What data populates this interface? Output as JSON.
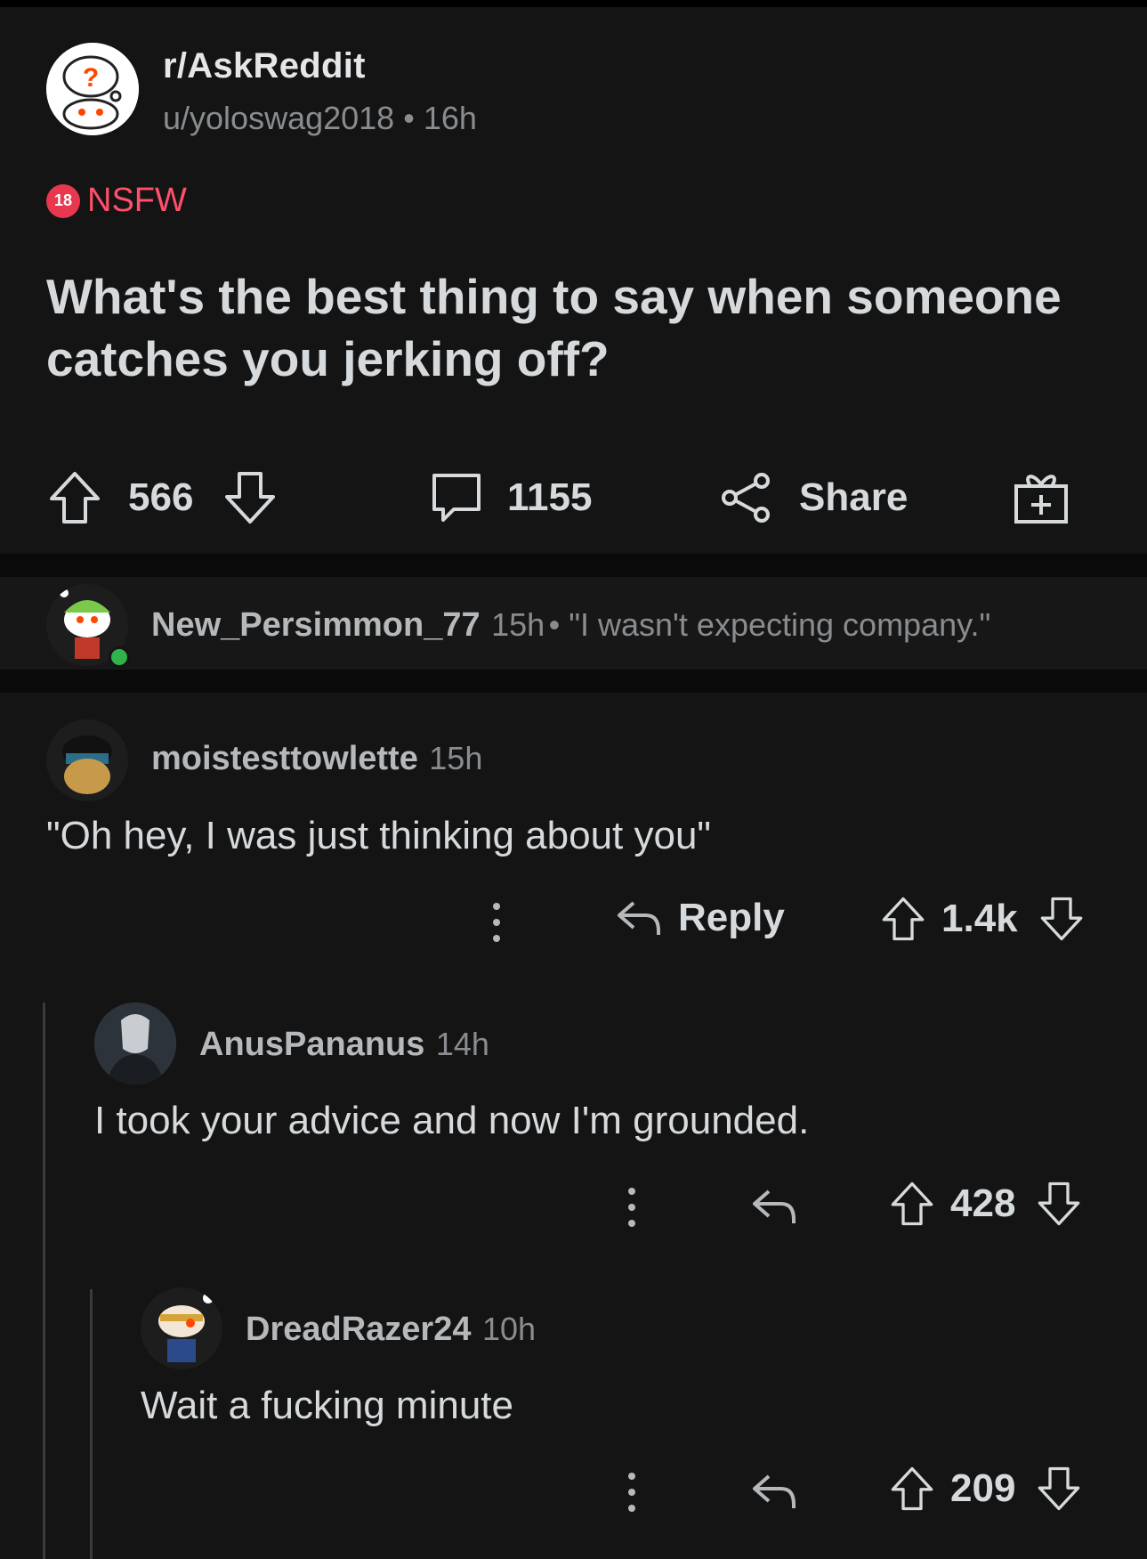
{
  "post": {
    "subreddit": "r/AskReddit",
    "author": "u/yoloswag2018",
    "time": "16h",
    "nsfw_badge": "18",
    "nsfw_label": "NSFW",
    "title": "What's the best thing to say when someone catches you jerking off?",
    "upvotes": "566",
    "comments": "1155",
    "share_label": "Share",
    "award_icon": "award-icon"
  },
  "collapsed_comment": {
    "user": "New_Persimmon_77",
    "time": "15h",
    "text": "\"I wasn't expecting company.\""
  },
  "comments": [
    {
      "user": "moistesttowlette",
      "time": "15h",
      "body": "\"Oh hey, I was just thinking about you\"",
      "reply_label": "Reply",
      "score": "1.4k"
    },
    {
      "user": "AnusPananus",
      "time": "14h",
      "body": "I took your advice and now I'm grounded.",
      "score": "428"
    },
    {
      "user": "DreadRazer24",
      "time": "10h",
      "body": "Wait a fucking minute",
      "score": "209"
    }
  ],
  "colors": {
    "background": "#141414",
    "nsfw": "#ff4f6a",
    "online": "#2fb34a"
  }
}
